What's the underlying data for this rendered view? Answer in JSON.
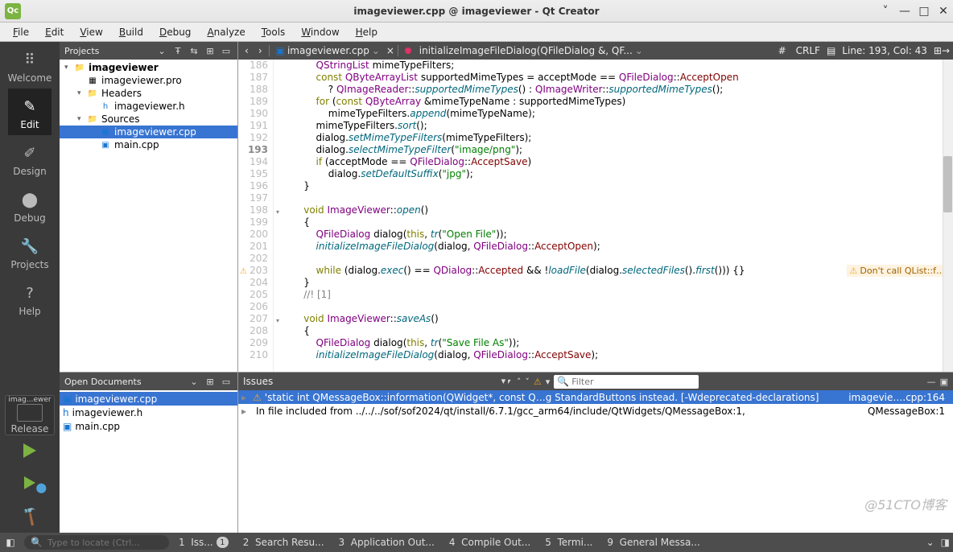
{
  "window": {
    "title": "imageviewer.cpp @ imageviewer - Qt Creator"
  },
  "menubar": [
    "File",
    "Edit",
    "View",
    "Build",
    "Debug",
    "Analyze",
    "Tools",
    "Window",
    "Help"
  ],
  "modes": [
    {
      "id": "welcome",
      "label": "Welcome"
    },
    {
      "id": "edit",
      "label": "Edit"
    },
    {
      "id": "design",
      "label": "Design"
    },
    {
      "id": "debug",
      "label": "Debug"
    },
    {
      "id": "projects",
      "label": "Projects"
    },
    {
      "id": "help",
      "label": "Help"
    }
  ],
  "kit": {
    "project": "imag...ewer",
    "build": "Release"
  },
  "panes": {
    "projects_title": "Projects",
    "opendocs_title": "Open Documents",
    "issues_title": "Issues"
  },
  "project_tree": [
    {
      "depth": 0,
      "arrow": "▾",
      "icon": "folder",
      "name": "imageviewer",
      "bold": true
    },
    {
      "depth": 1,
      "arrow": "",
      "icon": "pro",
      "name": "imageviewer.pro"
    },
    {
      "depth": 1,
      "arrow": "▾",
      "icon": "folder",
      "name": "Headers"
    },
    {
      "depth": 2,
      "arrow": "",
      "icon": "h",
      "name": "imageviewer.h"
    },
    {
      "depth": 1,
      "arrow": "▾",
      "icon": "folder",
      "name": "Sources"
    },
    {
      "depth": 2,
      "arrow": "",
      "icon": "cpp",
      "name": "imageviewer.cpp",
      "sel": true
    },
    {
      "depth": 2,
      "arrow": "",
      "icon": "cpp",
      "name": "main.cpp"
    }
  ],
  "open_docs": [
    {
      "icon": "cpp",
      "name": "imageviewer.cpp",
      "sel": true
    },
    {
      "icon": "h",
      "name": "imageviewer.h"
    },
    {
      "icon": "cpp",
      "name": "main.cpp"
    }
  ],
  "editor": {
    "file": "imageviewer.cpp",
    "symbol": "initializeImageFileDialog(QFileDialog &, QF...",
    "hash": "#",
    "line_ending": "CRLF",
    "pos": "Line: 193, Col: 43",
    "lines_start": 186,
    "current_line": 193,
    "fold_lines": [
      198,
      207
    ],
    "warn_lines": [
      203
    ],
    "code": [
      {
        "i": "        ",
        "parts": [
          {
            "t": "QStringList ",
            "c": "type"
          },
          {
            "t": "mimeTypeFilters;",
            "c": "op"
          }
        ]
      },
      {
        "i": "        ",
        "parts": [
          {
            "t": "const ",
            "c": "kw"
          },
          {
            "t": "QByteArrayList ",
            "c": "type"
          },
          {
            "t": "supportedMimeTypes ",
            "c": "op"
          },
          {
            "t": "= ",
            "c": "op"
          },
          {
            "t": "acceptMode ",
            "c": "op"
          },
          {
            "t": "== ",
            "c": "op"
          },
          {
            "t": "QFileDialog",
            "c": "cls"
          },
          {
            "t": "::",
            "c": "op"
          },
          {
            "t": "AcceptOpen",
            "c": "mem"
          }
        ]
      },
      {
        "i": "            ",
        "parts": [
          {
            "t": "? ",
            "c": "op"
          },
          {
            "t": "QImageReader",
            "c": "cls"
          },
          {
            "t": "::",
            "c": "op"
          },
          {
            "t": "supportedMimeTypes",
            "c": "fn"
          },
          {
            "t": "() : ",
            "c": "op"
          },
          {
            "t": "QImageWriter",
            "c": "cls"
          },
          {
            "t": "::",
            "c": "op"
          },
          {
            "t": "supportedMimeTypes",
            "c": "fn"
          },
          {
            "t": "();",
            "c": "op"
          }
        ]
      },
      {
        "i": "        ",
        "parts": [
          {
            "t": "for ",
            "c": "kw"
          },
          {
            "t": "(",
            "c": "op"
          },
          {
            "t": "const ",
            "c": "kw"
          },
          {
            "t": "QByteArray ",
            "c": "type"
          },
          {
            "t": "&mimeTypeName : supportedMimeTypes)",
            "c": "op"
          }
        ]
      },
      {
        "i": "            ",
        "parts": [
          {
            "t": "mimeTypeFilters.",
            "c": "op"
          },
          {
            "t": "append",
            "c": "fn"
          },
          {
            "t": "(mimeTypeName);",
            "c": "op"
          }
        ]
      },
      {
        "i": "        ",
        "parts": [
          {
            "t": "mimeTypeFilters.",
            "c": "op"
          },
          {
            "t": "sort",
            "c": "fn"
          },
          {
            "t": "();",
            "c": "op"
          }
        ]
      },
      {
        "i": "        ",
        "parts": [
          {
            "t": "dialog.",
            "c": "op"
          },
          {
            "t": "setMimeTypeFilters",
            "c": "fn"
          },
          {
            "t": "(mimeTypeFilters);",
            "c": "op"
          }
        ]
      },
      {
        "i": "        ",
        "parts": [
          {
            "t": "dialog.",
            "c": "op"
          },
          {
            "t": "selectMimeTypeFilter",
            "c": "fn"
          },
          {
            "t": "(",
            "c": "op"
          },
          {
            "t": "\"image/png\"",
            "c": "str"
          },
          {
            "t": ");",
            "c": "op"
          }
        ]
      },
      {
        "i": "        ",
        "parts": [
          {
            "t": "if ",
            "c": "kw"
          },
          {
            "t": "(acceptMode == ",
            "c": "op"
          },
          {
            "t": "QFileDialog",
            "c": "cls"
          },
          {
            "t": "::",
            "c": "op"
          },
          {
            "t": "AcceptSave",
            "c": "mem"
          },
          {
            "t": ")",
            "c": "op"
          }
        ]
      },
      {
        "i": "            ",
        "parts": [
          {
            "t": "dialog.",
            "c": "op"
          },
          {
            "t": "setDefaultSuffix",
            "c": "fn"
          },
          {
            "t": "(",
            "c": "op"
          },
          {
            "t": "\"jpg\"",
            "c": "str"
          },
          {
            "t": ");",
            "c": "op"
          }
        ]
      },
      {
        "i": "    ",
        "parts": [
          {
            "t": "}",
            "c": "op"
          }
        ]
      },
      {
        "i": "",
        "parts": []
      },
      {
        "i": "    ",
        "parts": [
          {
            "t": "void ",
            "c": "kw"
          },
          {
            "t": "ImageViewer",
            "c": "cls"
          },
          {
            "t": "::",
            "c": "op"
          },
          {
            "t": "open",
            "c": "fn"
          },
          {
            "t": "()",
            "c": "op"
          }
        ]
      },
      {
        "i": "    ",
        "parts": [
          {
            "t": "{",
            "c": "op"
          }
        ]
      },
      {
        "i": "        ",
        "parts": [
          {
            "t": "QFileDialog ",
            "c": "type"
          },
          {
            "t": "dialog",
            "c": "op"
          },
          {
            "t": "(",
            "c": "op"
          },
          {
            "t": "this",
            "c": "kw"
          },
          {
            "t": ", ",
            "c": "op"
          },
          {
            "t": "tr",
            "c": "fn"
          },
          {
            "t": "(",
            "c": "op"
          },
          {
            "t": "\"Open File\"",
            "c": "str"
          },
          {
            "t": "));",
            "c": "op"
          }
        ]
      },
      {
        "i": "        ",
        "parts": [
          {
            "t": "initializeImageFileDialog",
            "c": "fn"
          },
          {
            "t": "(dialog, ",
            "c": "op"
          },
          {
            "t": "QFileDialog",
            "c": "cls"
          },
          {
            "t": "::",
            "c": "op"
          },
          {
            "t": "AcceptOpen",
            "c": "mem"
          },
          {
            "t": ");",
            "c": "op"
          }
        ]
      },
      {
        "i": "",
        "parts": []
      },
      {
        "i": "        ",
        "parts": [
          {
            "t": "while ",
            "c": "kw"
          },
          {
            "t": "(dialog.",
            "c": "op"
          },
          {
            "t": "exec",
            "c": "fn"
          },
          {
            "t": "() == ",
            "c": "op"
          },
          {
            "t": "QDialog",
            "c": "cls"
          },
          {
            "t": "::",
            "c": "op"
          },
          {
            "t": "Accepted ",
            "c": "mem"
          },
          {
            "t": "&& !",
            "c": "op"
          },
          {
            "t": "loadFile",
            "c": "fn"
          },
          {
            "t": "(dialog.",
            "c": "op"
          },
          {
            "t": "selectedFiles",
            "c": "fn"
          },
          {
            "t": "().",
            "c": "op"
          },
          {
            "t": "first",
            "c": "fn"
          },
          {
            "t": "())) {}",
            "c": "op"
          }
        ],
        "warn": "Don't call QList::f…"
      },
      {
        "i": "    ",
        "parts": [
          {
            "t": "}",
            "c": "op"
          }
        ]
      },
      {
        "i": "    ",
        "parts": [
          {
            "t": "//! [1]",
            "c": "cmt"
          }
        ]
      },
      {
        "i": "",
        "parts": []
      },
      {
        "i": "    ",
        "parts": [
          {
            "t": "void ",
            "c": "kw"
          },
          {
            "t": "ImageViewer",
            "c": "cls"
          },
          {
            "t": "::",
            "c": "op"
          },
          {
            "t": "saveAs",
            "c": "fn"
          },
          {
            "t": "()",
            "c": "op"
          }
        ]
      },
      {
        "i": "    ",
        "parts": [
          {
            "t": "{",
            "c": "op"
          }
        ]
      },
      {
        "i": "        ",
        "parts": [
          {
            "t": "QFileDialog ",
            "c": "type"
          },
          {
            "t": "dialog",
            "c": "op"
          },
          {
            "t": "(",
            "c": "op"
          },
          {
            "t": "this",
            "c": "kw"
          },
          {
            "t": ", ",
            "c": "op"
          },
          {
            "t": "tr",
            "c": "fn"
          },
          {
            "t": "(",
            "c": "op"
          },
          {
            "t": "\"Save File As\"",
            "c": "str"
          },
          {
            "t": "));",
            "c": "op"
          }
        ]
      },
      {
        "i": "        ",
        "parts": [
          {
            "t": "initializeImageFileDialog",
            "c": "fn"
          },
          {
            "t": "(dialog, ",
            "c": "op"
          },
          {
            "t": "QFileDialog",
            "c": "cls"
          },
          {
            "t": "::",
            "c": "op"
          },
          {
            "t": "AcceptSave",
            "c": "mem"
          },
          {
            "t": ");",
            "c": "op"
          }
        ]
      }
    ]
  },
  "issues": {
    "filter_placeholder": "Filter",
    "rows": [
      {
        "sel": true,
        "arrow": "▸",
        "icon": "⚠",
        "text": "'static int QMessageBox::information(QWidget*, const Q…g StandardButtons instead. [-Wdeprecated-declarations]",
        "loc": "imagevie….cpp:164"
      },
      {
        "sel": false,
        "arrow": "▸",
        "icon": "",
        "text": "In file included from ../../../sof/sof2024/qt/install/6.7.1/gcc_arm64/include/QtWidgets/QMessageBox:1,",
        "loc": "QMessageBox:1"
      }
    ]
  },
  "status": {
    "locator_placeholder": "Type to locate (Ctrl...",
    "tabs": [
      {
        "n": "1",
        "label": "Iss...",
        "badge": "1"
      },
      {
        "n": "2",
        "label": "Search Resu..."
      },
      {
        "n": "3",
        "label": "Application Out..."
      },
      {
        "n": "4",
        "label": "Compile Out..."
      },
      {
        "n": "5",
        "label": "Termi..."
      },
      {
        "n": "9",
        "label": "General Messa..."
      }
    ]
  },
  "watermark": "@51CTO博客"
}
